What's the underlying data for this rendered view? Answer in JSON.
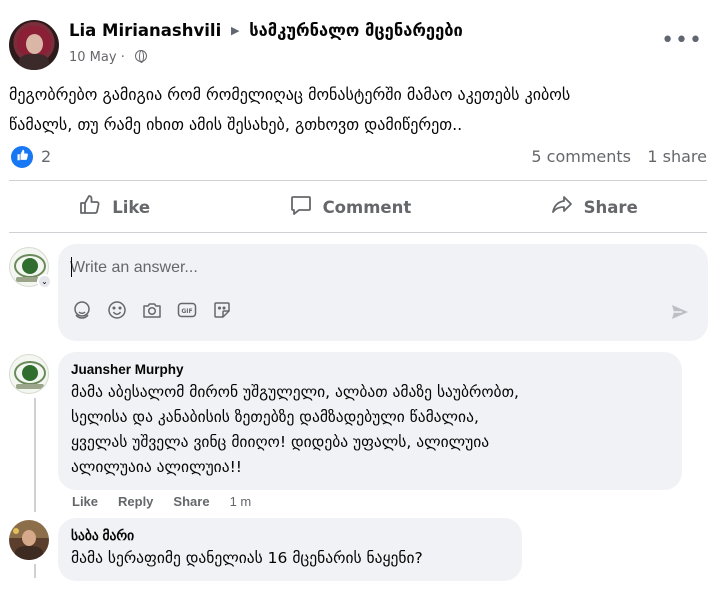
{
  "post": {
    "author": "Lia Mirianashvili",
    "group": "სამკურნალო მცენარეები",
    "date": "10 May",
    "date_separator": "·",
    "text_line1": "მეგობრებო გამიგია რომ რომელიღაც მონასტერში მამაო აკეთებს კიბოს",
    "text_line2": "წამალს, თუ რამე იხით ამის შესახებ, გთხოვთ დამიწერეთ..",
    "more_label": "•••"
  },
  "stats": {
    "likes": "2",
    "comments": "5 comments",
    "shares": "1 share"
  },
  "actions": {
    "like": "Like",
    "comment": "Comment",
    "share": "Share"
  },
  "composer": {
    "placeholder": "Write an answer...",
    "tools": [
      "avatar-sticker-icon",
      "emoji-icon",
      "camera-icon",
      "gif-icon",
      "sticker-icon"
    ],
    "send_icon": "send-icon"
  },
  "comments": [
    {
      "author": "Juansher Murphy",
      "lines": [
        "მამა აბესალომ მირონ უშგულელი, ალბათ ამაზე საუბრობთ,",
        "სელისა და კანაბისის ზეთებზე დამზადებული წამალია,",
        "ყველას უშველა ვინც მიიღო! დიდება უფალს, ალილუია",
        "ალილუაია ალილუია!!"
      ],
      "like_label": "Like",
      "reply_label": "Reply",
      "share_label": "Share",
      "time": "1 m"
    },
    {
      "author": "საბა მარი",
      "lines": [
        "მამა სერაფიმე დანელიას 16 მცენარის ნაყენი?"
      ]
    }
  ],
  "colors": {
    "accent": "#1877f2",
    "muted": "#65676b",
    "bubble": "#f0f2f5",
    "divider": "#ced0d4"
  }
}
